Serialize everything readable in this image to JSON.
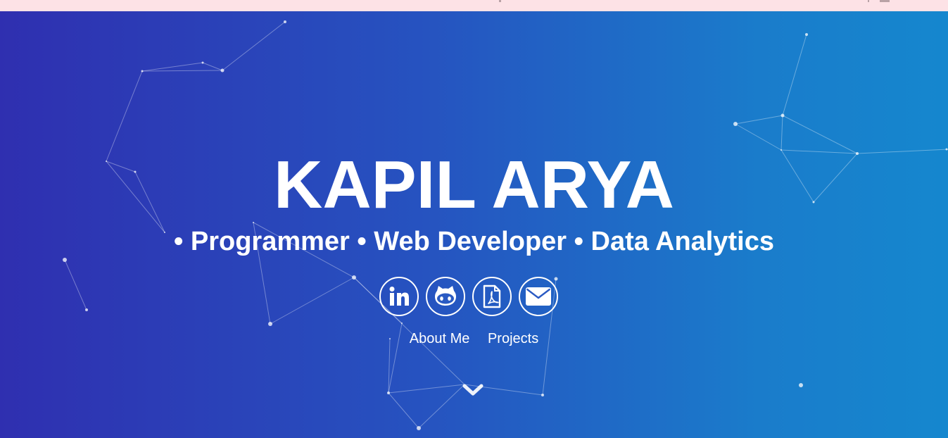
{
  "hero": {
    "name": "KAPIL ARYA",
    "tagline": "• Programmer • Web Developer • Data Analytics"
  },
  "socials": [
    {
      "name": "linkedin",
      "icon": "linkedin-icon"
    },
    {
      "name": "github",
      "icon": "github-icon"
    },
    {
      "name": "resume-pdf",
      "icon": "pdf-icon"
    },
    {
      "name": "email",
      "icon": "mail-icon"
    }
  ],
  "nav": {
    "about_label": "About Me",
    "projects_label": "Projects"
  },
  "scroll_icon": "chevron-down-icon",
  "colors": {
    "topbar": "#fde2e6",
    "gradient_start": "#2f2fb0",
    "gradient_end": "#1587ce",
    "text": "#ffffff"
  }
}
